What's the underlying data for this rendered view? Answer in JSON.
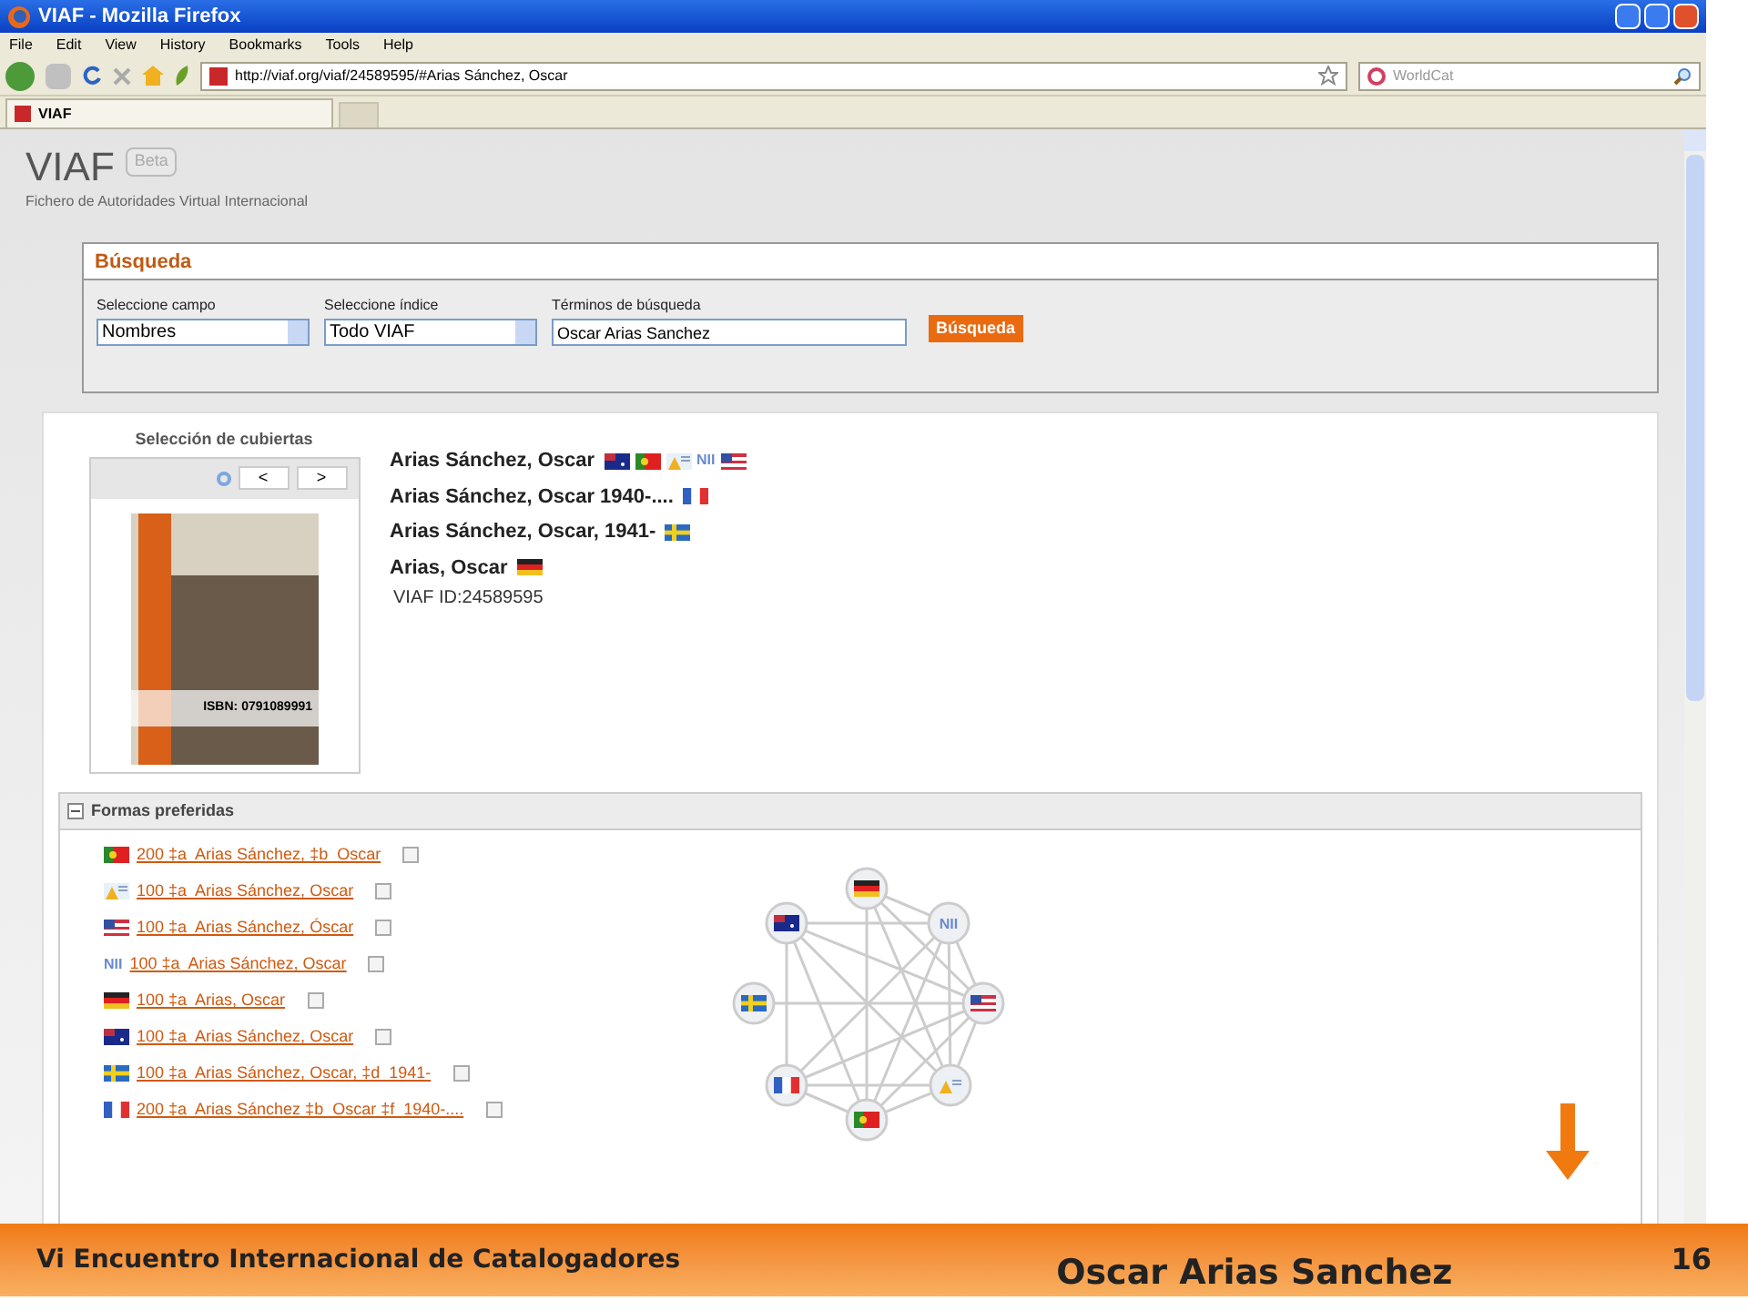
{
  "window": {
    "title": "VIAF - Mozilla Firefox"
  },
  "menu": [
    "File",
    "Edit",
    "View",
    "History",
    "Bookmarks",
    "Tools",
    "Help"
  ],
  "address_bar": {
    "value": "http://viaf.org/viaf/24589595/#Arias Sánchez, Oscar"
  },
  "search_bar": {
    "placeholder": "WorldCat"
  },
  "tabs": [
    {
      "label": "VIAF",
      "selected": true
    }
  ],
  "site": {
    "logo": "VIAF",
    "badge": "Beta",
    "subtitle": "Fichero de Autoridades Virtual Internacional"
  },
  "search": {
    "title": "Búsqueda",
    "fields": [
      {
        "kind": "select",
        "label": "Seleccione campo",
        "value": "Nombres"
      },
      {
        "kind": "select",
        "label": "Seleccione índice",
        "value": "Todo VIAF"
      },
      {
        "kind": "text",
        "label": "Términos de búsqueda",
        "value": "Oscar Arias Sanchez"
      }
    ],
    "button": "Búsqueda"
  },
  "covers": {
    "title": "Selección de cubiertas",
    "isbn": "ISBN: 0791089991",
    "prev": "<",
    "next": ">"
  },
  "headings": [
    {
      "text": "Arias Sánchez, Oscar",
      "flags": [
        {
          "kind": "au"
        },
        {
          "kind": "pt"
        },
        {
          "kind": "isni"
        },
        {
          "kind": "nii",
          "text": "NII"
        },
        {
          "kind": "us"
        }
      ]
    },
    {
      "text": "Arias Sánchez, Oscar 1940-....",
      "flags": [
        {
          "kind": "fr"
        }
      ]
    },
    {
      "text": "Arias Sánchez, Oscar, 1941-",
      "flags": [
        {
          "kind": "se"
        }
      ]
    },
    {
      "text": "Arias, Oscar",
      "flags": [
        {
          "kind": "de"
        }
      ]
    }
  ],
  "viaf_id": "VIAF ID:24589595",
  "preferred": {
    "title": "Formas preferidas",
    "expanded": true,
    "items": [
      {
        "flag": {
          "kind": "pt"
        },
        "text": "200 ‡a  Arias Sánchez, ‡b  Oscar"
      },
      {
        "flag": {
          "kind": "isni"
        },
        "text": "100 ‡a  Arias Sánchez, Oscar"
      },
      {
        "flag": {
          "kind": "us"
        },
        "text": "100 ‡a  Arias Sánchez, Óscar"
      },
      {
        "flag": {
          "kind": "nii",
          "text": "NII"
        },
        "text": "100 ‡a  Arias Sánchez, Oscar"
      },
      {
        "flag": {
          "kind": "de"
        },
        "text": "100 ‡a  Arias, Oscar"
      },
      {
        "flag": {
          "kind": "au"
        },
        "text": "100 ‡a  Arias Sánchez, Oscar"
      },
      {
        "flag": {
          "kind": "se"
        },
        "text": "100 ‡a  Arias Sánchez, Oscar, ‡d  1941-"
      },
      {
        "flag": {
          "kind": "fr"
        },
        "text": "200 ‡a  Arias Sánchez ‡b  Oscar ‡f  1940-...."
      }
    ]
  },
  "network_nodes": [
    {
      "kind": "de"
    },
    {
      "kind": "nii",
      "text": "NII"
    },
    {
      "kind": "au"
    },
    {
      "kind": "se"
    },
    {
      "kind": "us"
    },
    {
      "kind": "fr"
    },
    {
      "kind": "isni"
    },
    {
      "kind": "pt"
    }
  ],
  "footer": {
    "event": "Vi Encuentro Internacional de Catalogadores",
    "title": "Oscar Arias Sanchez",
    "page": "16"
  }
}
